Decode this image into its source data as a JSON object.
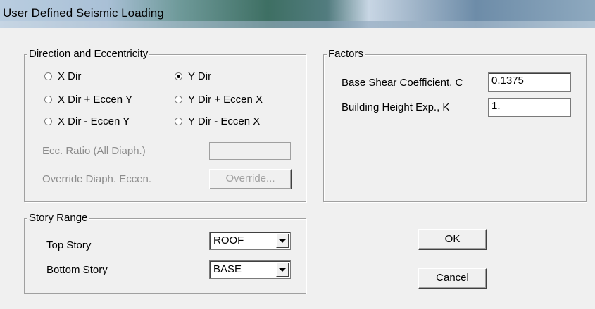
{
  "window": {
    "title": "User Defined Seismic Loading"
  },
  "direction_group": {
    "legend": "Direction and Eccentricity",
    "options": [
      {
        "label": "X Dir",
        "selected": false
      },
      {
        "label": "X Dir + Eccen Y",
        "selected": false
      },
      {
        "label": "X Dir - Eccen Y",
        "selected": false
      },
      {
        "label": "Y Dir",
        "selected": true
      },
      {
        "label": "Y Dir + Eccen X",
        "selected": false
      },
      {
        "label": "Y Dir - Eccen X",
        "selected": false
      }
    ],
    "ecc_ratio_label": "Ecc. Ratio (All Diaph.)",
    "ecc_ratio_value": "",
    "override_label": "Override Diaph. Eccen.",
    "override_button": "Override..."
  },
  "factors_group": {
    "legend": "Factors",
    "base_shear_label": "Base Shear Coefficient, C",
    "base_shear_value": "0.1375",
    "height_exp_label": "Building Height Exp., K",
    "height_exp_value": "1."
  },
  "story_range_group": {
    "legend": "Story Range",
    "top_story_label": "Top Story",
    "top_story_value": "ROOF",
    "bottom_story_label": "Bottom Story",
    "bottom_story_value": "BASE"
  },
  "buttons": {
    "ok": "OK",
    "cancel": "Cancel"
  }
}
